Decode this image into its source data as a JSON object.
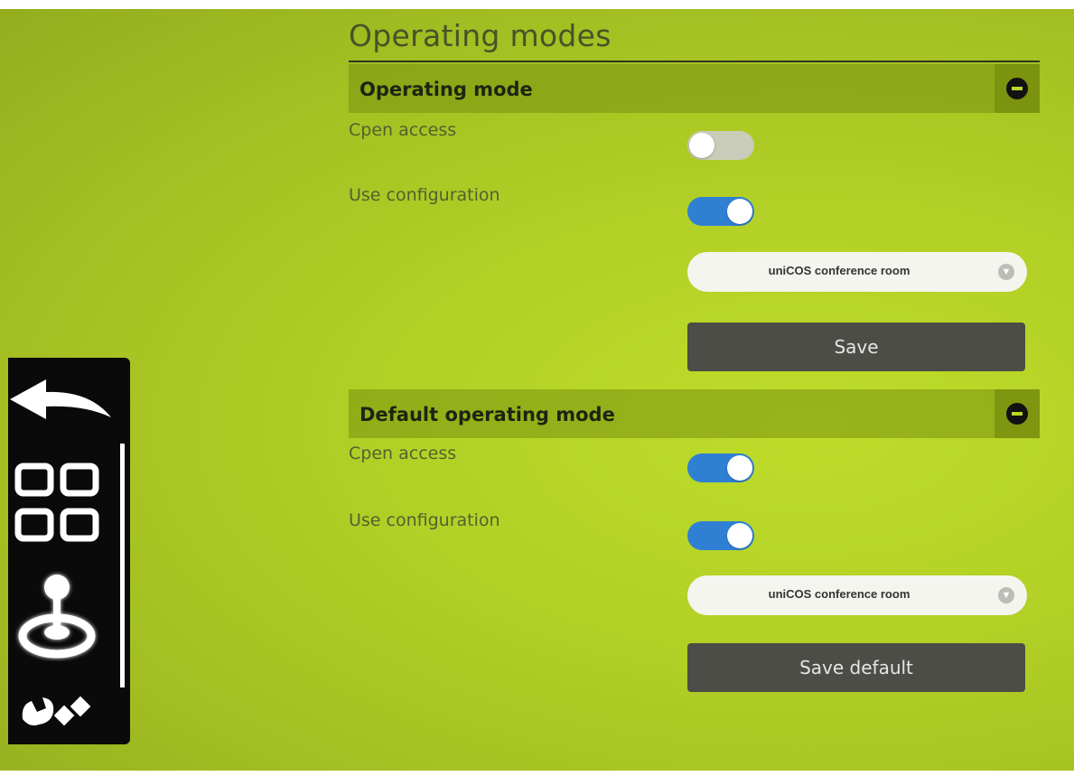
{
  "page": {
    "title": "Operating modes"
  },
  "sections": [
    {
      "header": "Operating mode",
      "open_access": {
        "label": "Cpen access",
        "on": false
      },
      "use_configuration": {
        "label": "Use configuration",
        "on": true
      },
      "select": {
        "value": "uniCOS conference room"
      },
      "button": "Save"
    },
    {
      "header": "Default operating mode",
      "open_access": {
        "label": "Cpen access",
        "on": true
      },
      "use_configuration": {
        "label": "Use configuration",
        "on": true
      },
      "select": {
        "value": "uniCOS conference room"
      },
      "button": "Save default"
    }
  ],
  "nav": {
    "items": [
      "back-arrow-icon",
      "grid-icon",
      "joystick-icon",
      "tools-icon"
    ]
  },
  "colors": {
    "accent": "#2f80d3",
    "background": "#b3d126",
    "button": "#4b4d46"
  }
}
